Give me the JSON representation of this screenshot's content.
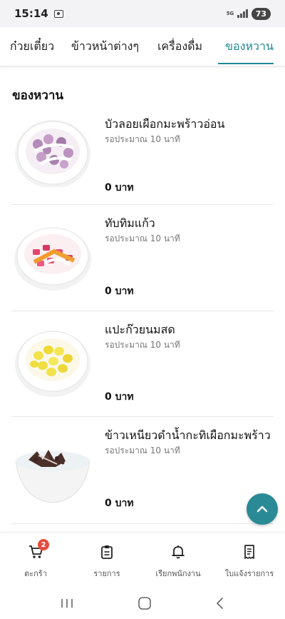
{
  "status": {
    "time": "15:14",
    "network": "5G",
    "battery": "73"
  },
  "tabs": [
    {
      "label": "ก๋วยเตี๋ยว",
      "active": false
    },
    {
      "label": "ข้าวหน้าต่างๆ",
      "active": false
    },
    {
      "label": "เครื่องดื่ม",
      "active": false
    },
    {
      "label": "ของหวาน",
      "active": true
    }
  ],
  "section": {
    "title": "ของหวาน"
  },
  "items": [
    {
      "name": "บัวลอยเผือกมะพร้าวอ่อน",
      "wait": "รอประมาณ 10 นาที",
      "price": "0 บาท",
      "icon": "taro-balls-coconut-milk-bowl"
    },
    {
      "name": "ทับทิมแก้ว",
      "wait": "รอประมาณ 10 นาที",
      "price": "0 บาท",
      "icon": "red-rubies-bowl"
    },
    {
      "name": "แปะก๊วยนมสด",
      "wait": "รอประมาณ 10 นาที",
      "price": "0 บาท",
      "icon": "ginkgo-milk-bowl"
    },
    {
      "name": "ข้าวเหนียวดำน้ำกะทิเผือกมะพร้าว",
      "wait": "รอประมาณ 10 นาที",
      "price": "0 บาท",
      "icon": "black-sticky-rice-coconut-bowl"
    }
  ],
  "bottom_nav": [
    {
      "label": "ตะกร้า",
      "icon": "cart-icon",
      "badge": "2"
    },
    {
      "label": "รายการ",
      "icon": "clipboard-icon"
    },
    {
      "label": "เรียกพนักงาน",
      "icon": "bell-icon"
    },
    {
      "label": "ใบแจ้งรายการ",
      "icon": "receipt-icon"
    }
  ],
  "colors": {
    "accent": "#1e8994",
    "fab": "#2a8a95",
    "badge": "#e74c3c"
  }
}
